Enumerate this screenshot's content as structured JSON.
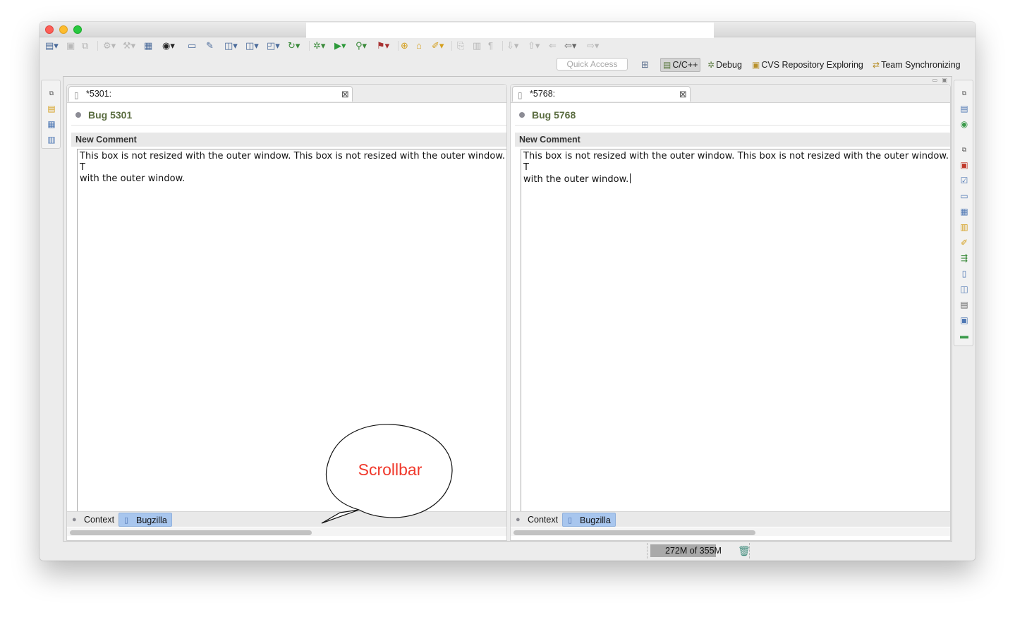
{
  "window": {
    "toolbar_icons": [
      "new-file-icon",
      "save-icon",
      "save-all-icon",
      "build-icon",
      "hammer-icon",
      "binary-icon",
      "target-icon",
      "monitor-icon",
      "pin-icon",
      "new-class-icon",
      "new-folder-icon",
      "new-source-icon",
      "refresh-icon",
      "debug-bug-icon",
      "run-icon",
      "run-config-icon",
      "external-tool-icon",
      "open-type-icon",
      "open-folder-icon",
      "search-icon",
      "toggle-mark-icon",
      "block-select-icon",
      "show-whitespace-icon",
      "next-annotation-icon",
      "prev-annotation-icon",
      "last-edit-icon",
      "back-icon",
      "forward-icon"
    ]
  },
  "perspectives": {
    "quick_access_placeholder": "Quick Access",
    "items": [
      {
        "label": "C/C++",
        "icon": "c-cpp-perspective-icon",
        "active": true
      },
      {
        "label": "Debug",
        "icon": "debug-bug-icon",
        "active": false
      },
      {
        "label": "CVS Repository Exploring",
        "icon": "cvs-icon",
        "active": false
      },
      {
        "label": "Team Synchronizing",
        "icon": "sync-icon",
        "active": false
      }
    ]
  },
  "editors": [
    {
      "tab_title": "*5301:",
      "bug_title": "Bug 5301",
      "section": "New Comment",
      "comment": "This box is not resized with the outer window. This box is not resized with the outer window. T\nwith the outer window.",
      "bottom_tabs": [
        {
          "label": "Context",
          "active": false
        },
        {
          "label": "Bugzilla",
          "active": true
        }
      ]
    },
    {
      "tab_title": "*5768:",
      "bug_title": "Bug 5768",
      "section": "New Comment",
      "comment": "This box is not resized with the outer window. This box is not resized with the outer window. T\nwith the outer window.",
      "bottom_tabs": [
        {
          "label": "Context",
          "active": false
        },
        {
          "label": "Bugzilla",
          "active": true
        }
      ]
    }
  ],
  "status": {
    "heap": "272M of 355M",
    "heap_used_fraction": 0.766
  },
  "annotation": {
    "callout_text": "Scrollbar",
    "callout_color": "#f0382b"
  }
}
